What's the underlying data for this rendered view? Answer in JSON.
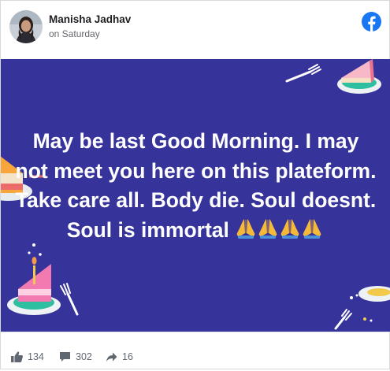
{
  "author": {
    "name": "Manisha Jadhav",
    "time": "on Saturday"
  },
  "post": {
    "text": "May be last Good Morning. I may not meet you here on this plateform. Take care all. Body die. Soul doesnt. Soul is immortal",
    "emoji_count": 4,
    "background_color": "#36339a",
    "text_color": "#ffffff"
  },
  "stats": {
    "likes": "134",
    "comments": "302",
    "shares": "16"
  },
  "brand": {
    "facebook_color": "#1877f2"
  }
}
